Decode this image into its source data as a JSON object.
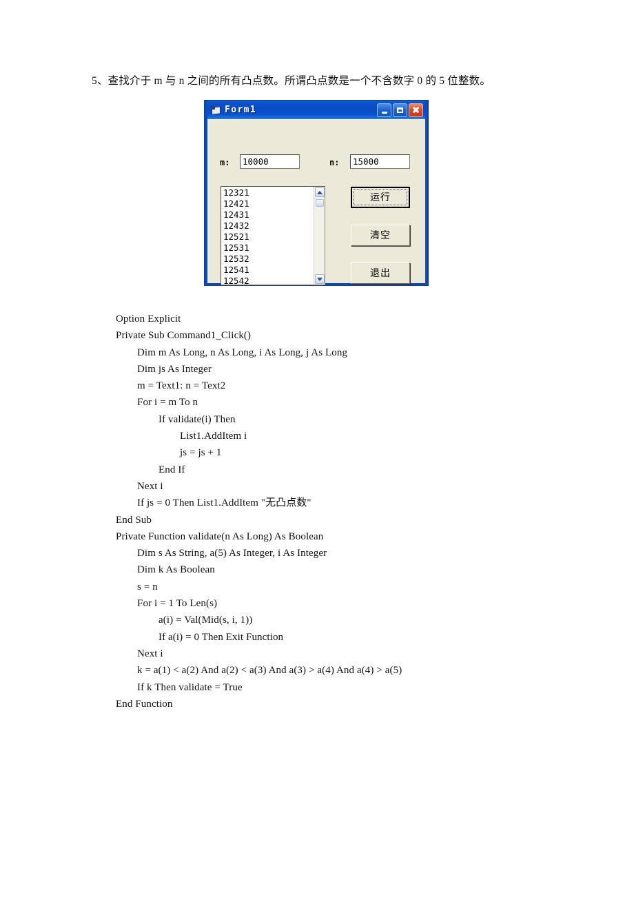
{
  "question": {
    "text": "5、查找介于 m 与 n 之间的所有凸点数。所谓凸点数是一个不含数字 0 的 5 位整数。"
  },
  "form": {
    "title": "Form1",
    "title_icon": "form-icon",
    "window_buttons": {
      "minimize": "minimize-icon",
      "maximize": "maximize-icon",
      "close": "close-icon"
    },
    "fields": [
      {
        "label": "m:",
        "value": "10000"
      },
      {
        "label": "n:",
        "value": "15000"
      }
    ],
    "listbox": {
      "items": [
        "12321",
        "12421",
        "12431",
        "12432",
        "12521",
        "12531",
        "12532",
        "12541",
        "12542"
      ],
      "scrollbar": {
        "up_arrow": "scroll-up-icon",
        "down_arrow": "scroll-down-icon"
      }
    },
    "buttons": [
      {
        "name": "run",
        "label": "运行"
      },
      {
        "name": "clear",
        "label": "清空"
      },
      {
        "name": "exit",
        "label": "退出"
      }
    ]
  },
  "code": {
    "lines": [
      {
        "indent": 0,
        "text": "Option Explicit"
      },
      {
        "indent": 0,
        "text": "Private Sub Command1_Click()"
      },
      {
        "indent": 1,
        "text": "Dim m As Long, n As Long, i As Long, j As Long"
      },
      {
        "indent": 1,
        "text": "Dim js As Integer"
      },
      {
        "indent": 1,
        "text": "m = Text1: n = Text2"
      },
      {
        "indent": 1,
        "text": "For i = m To n"
      },
      {
        "indent": 2,
        "text": "If validate(i) Then"
      },
      {
        "indent": 3,
        "text": "List1.AddItem i"
      },
      {
        "indent": 3,
        "text": "js = js + 1"
      },
      {
        "indent": 2,
        "text": "End If"
      },
      {
        "indent": 1,
        "text": "Next i"
      },
      {
        "indent": 1,
        "text": "If js = 0 Then List1.AddItem \"无凸点数\""
      },
      {
        "indent": 0,
        "text": "End Sub"
      },
      {
        "indent": 0,
        "text": "Private Function validate(n As Long) As Boolean"
      },
      {
        "indent": 1,
        "text": "Dim s As String, a(5) As Integer, i As Integer"
      },
      {
        "indent": 1,
        "text": "Dim k As Boolean"
      },
      {
        "indent": 1,
        "text": "s = n"
      },
      {
        "indent": 1,
        "text": "For i = 1 To Len(s)"
      },
      {
        "indent": 2,
        "text": "a(i) = Val(Mid(s, i, 1))"
      },
      {
        "indent": 2,
        "text": "If a(i) = 0 Then Exit Function"
      },
      {
        "indent": 1,
        "text": "Next i"
      },
      {
        "indent": 1,
        "text": "k = a(1) < a(2) And a(2) < a(3) And a(3) > a(4) And a(4) > a(5)"
      },
      {
        "indent": 1,
        "text": "If k Then validate = True"
      },
      {
        "indent": 0,
        "text": "End Function"
      }
    ]
  },
  "colors": {
    "titlebar_blue": "#0a4fc4",
    "form_face": "#ece9d8",
    "close_red": "#df4b25",
    "page_background": "#ffffff"
  }
}
